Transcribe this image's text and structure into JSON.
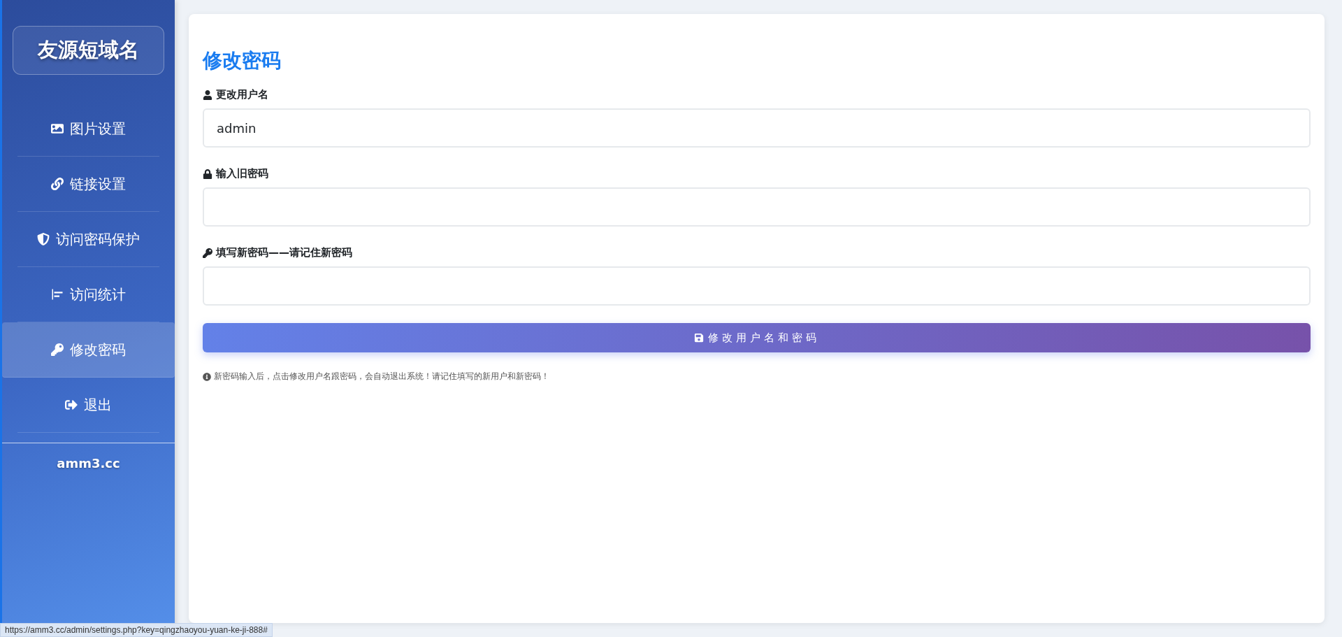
{
  "sidebar": {
    "logo": "友源短域名",
    "items": [
      {
        "kind": "image",
        "label": "图片设置",
        "selected": false
      },
      {
        "kind": "link",
        "label": "链接设置",
        "selected": false
      },
      {
        "kind": "shield",
        "label": "访问密码保护",
        "selected": false
      },
      {
        "kind": "chart",
        "label": "访问统计",
        "selected": false
      },
      {
        "kind": "key",
        "label": "修改密码",
        "selected": true
      },
      {
        "kind": "logout",
        "label": "退出",
        "selected": false
      }
    ],
    "footer": "amm3.cc"
  },
  "form": {
    "title": "修改密码",
    "fields": [
      {
        "kind": "user",
        "label": "更改用户名",
        "value": "admin"
      },
      {
        "kind": "lock",
        "label": "输入旧密码"
      },
      {
        "kind": "key",
        "label": "填写新密码——请记住新密码"
      }
    ],
    "submit": "修改用户名和密码",
    "note": "新密码输入后，点击修改用户名跟密码，会自动退出系统！请记住填写的新用户和新密码！"
  },
  "status_bar": {
    "url": "https://amm3.cc/admin/settings.php?key=qingzhaoyou-yuan-ke-ji-888#"
  }
}
